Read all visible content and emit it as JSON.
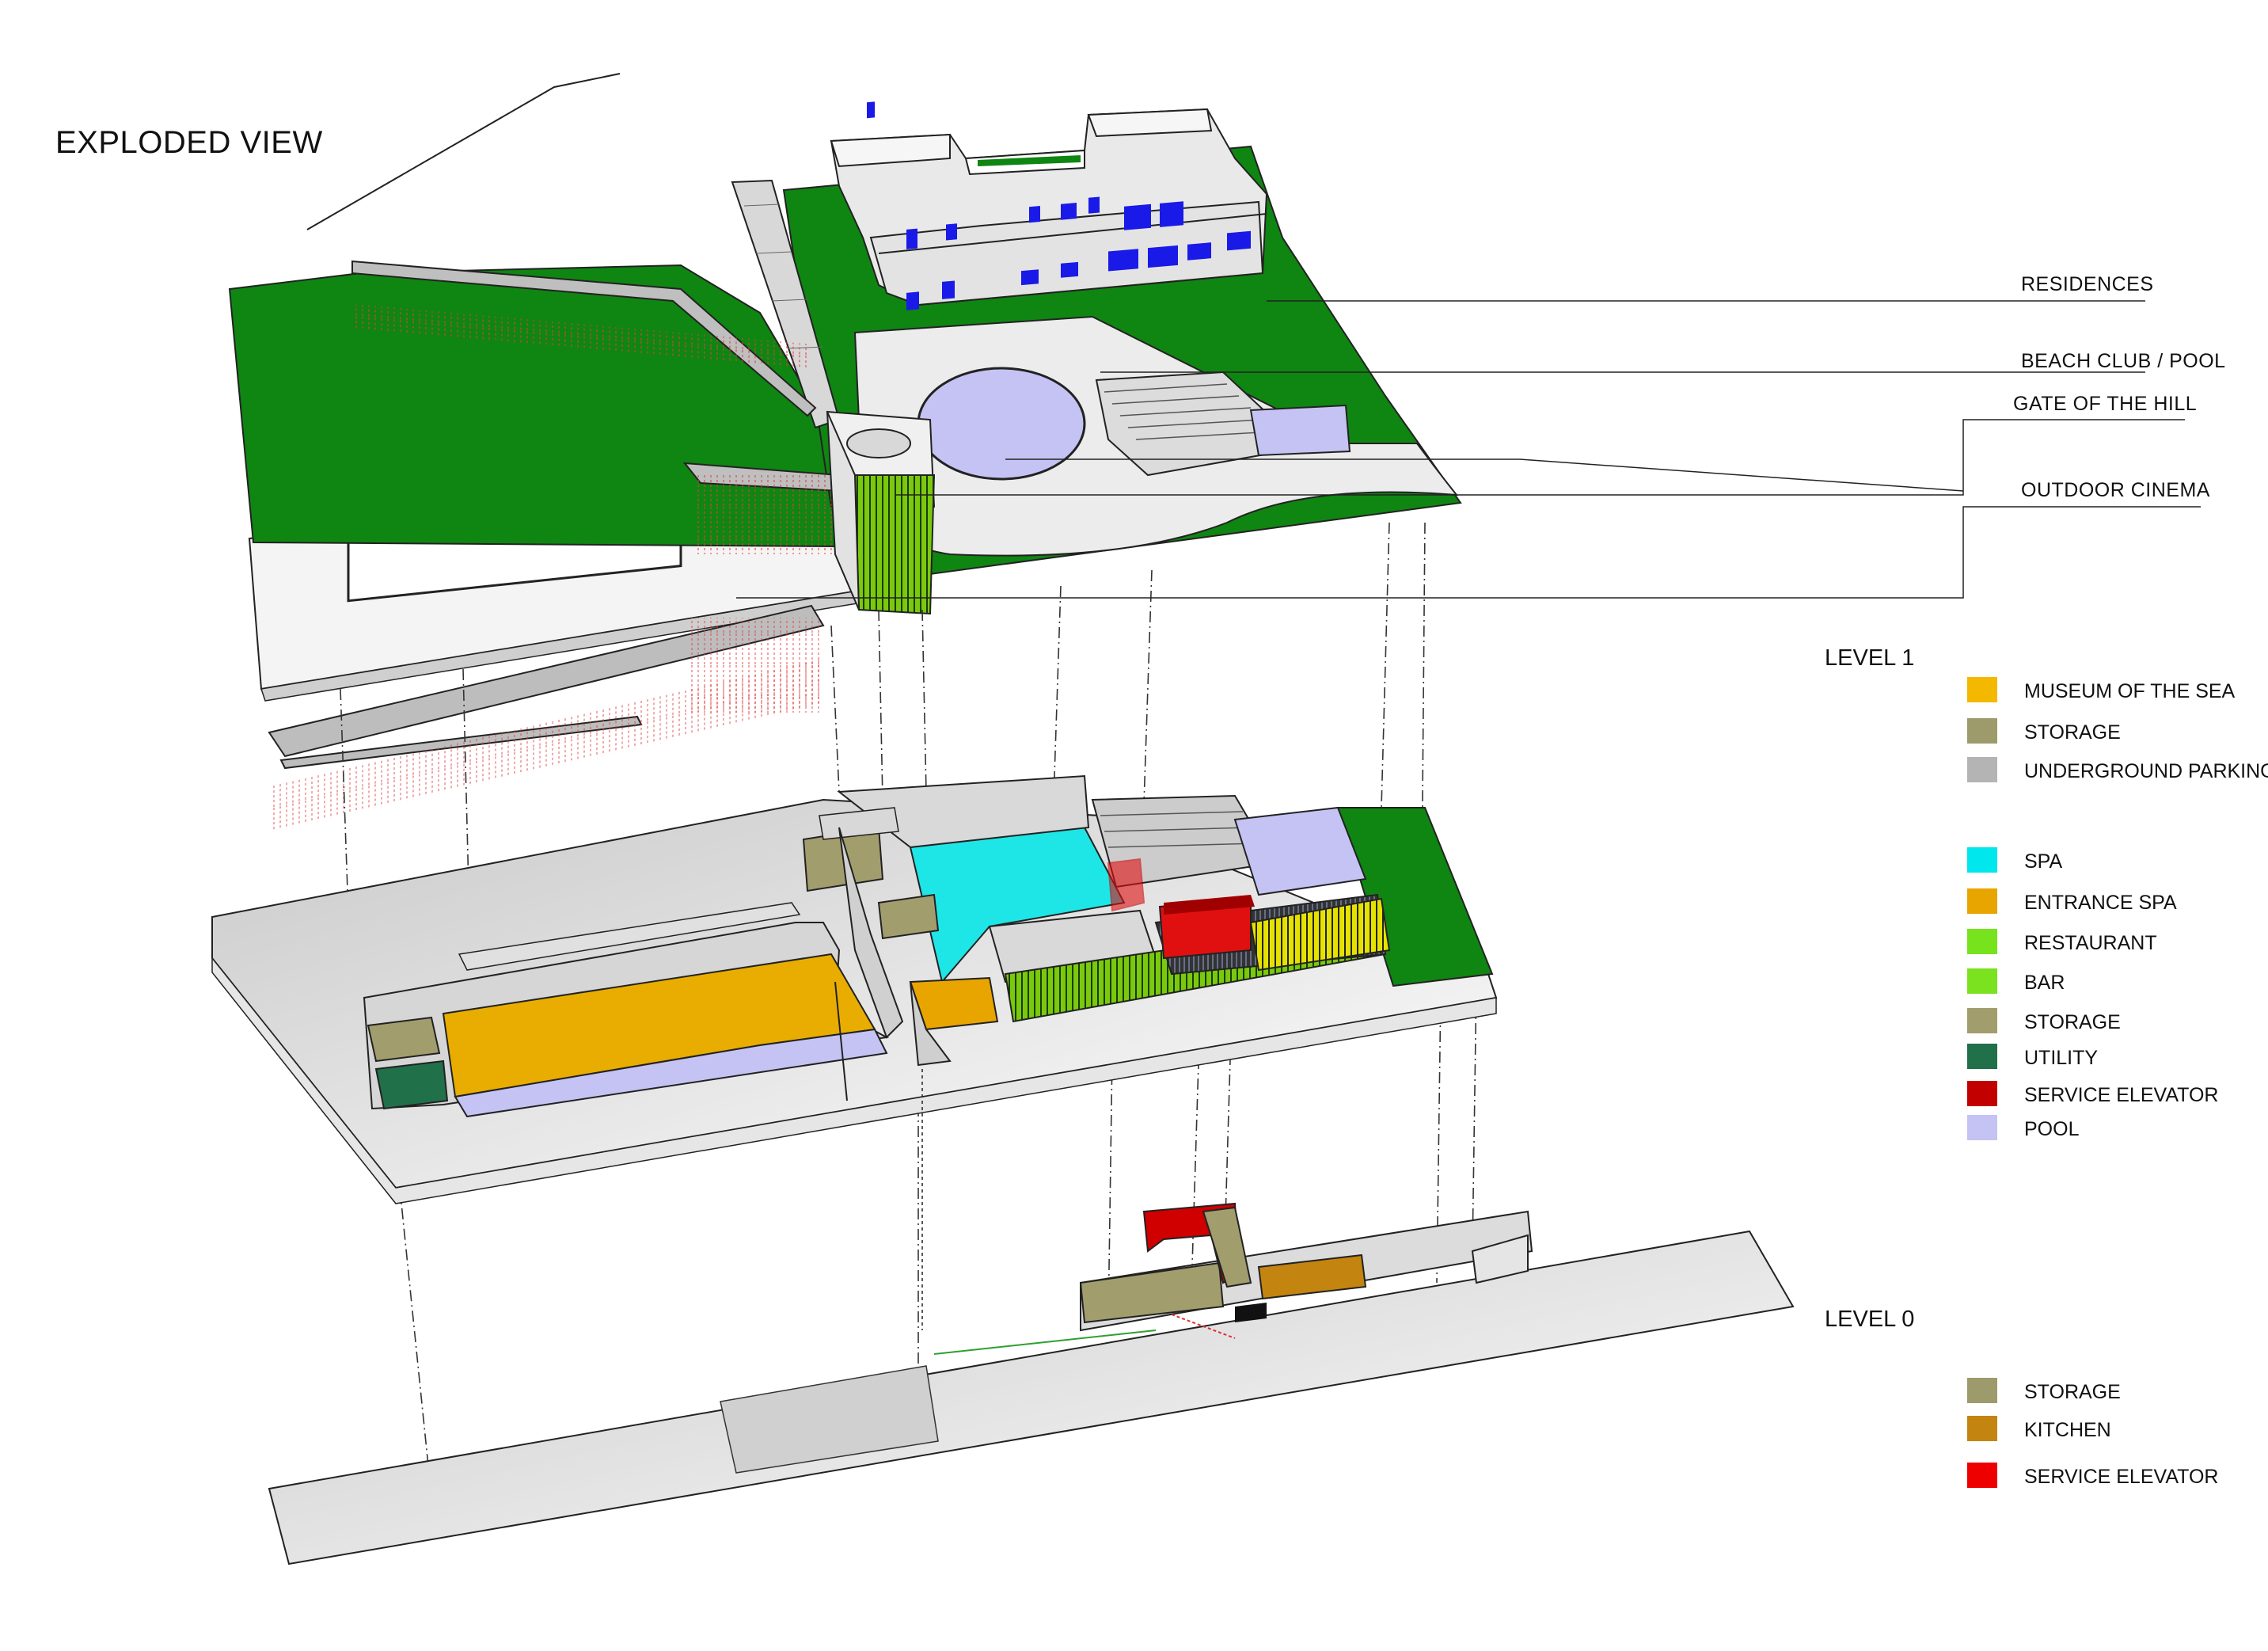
{
  "title": "EXPLODED VIEW",
  "callouts": [
    {
      "id": "residences",
      "label": "RESIDENCES"
    },
    {
      "id": "beach-club-pool",
      "label": "BEACH CLUB / POOL"
    },
    {
      "id": "gate-of-the-hill",
      "label": "GATE OF THE HILL"
    },
    {
      "id": "outdoor-cinema",
      "label": "OUTDOOR  CINEMA"
    }
  ],
  "legend_level1": {
    "title": "LEVEL 1",
    "items": [
      {
        "label": "MUSEUM OF THE SEA",
        "color": "#f5b800"
      },
      {
        "label": "STORAGE",
        "color": "#9d9a6c"
      },
      {
        "label": "UNDERGROUND PARKING",
        "color": "#b4b4b4"
      },
      {
        "label": "SPA",
        "color": "#00e7ee"
      },
      {
        "label": "ENTRANCE SPA",
        "color": "#e8a500"
      },
      {
        "label": "RESTAURANT",
        "color": "#76e31c"
      },
      {
        "label": "BAR",
        "color": "#7ae21f"
      },
      {
        "label": "STORAGE",
        "color": "#a29d6d"
      },
      {
        "label": "UTILITY",
        "color": "#20704a"
      },
      {
        "label": "SERVICE ELEVATOR",
        "color": "#c20000"
      },
      {
        "label": "POOL",
        "color": "#c4c3f4"
      }
    ]
  },
  "legend_level0": {
    "title": "LEVEL 0",
    "items": [
      {
        "label": "STORAGE",
        "color": "#9d9a6c"
      },
      {
        "label": "KITCHEN",
        "color": "#c38410"
      },
      {
        "label": "SERVICE ELEVATOR",
        "color": "#ee0000"
      }
    ]
  }
}
